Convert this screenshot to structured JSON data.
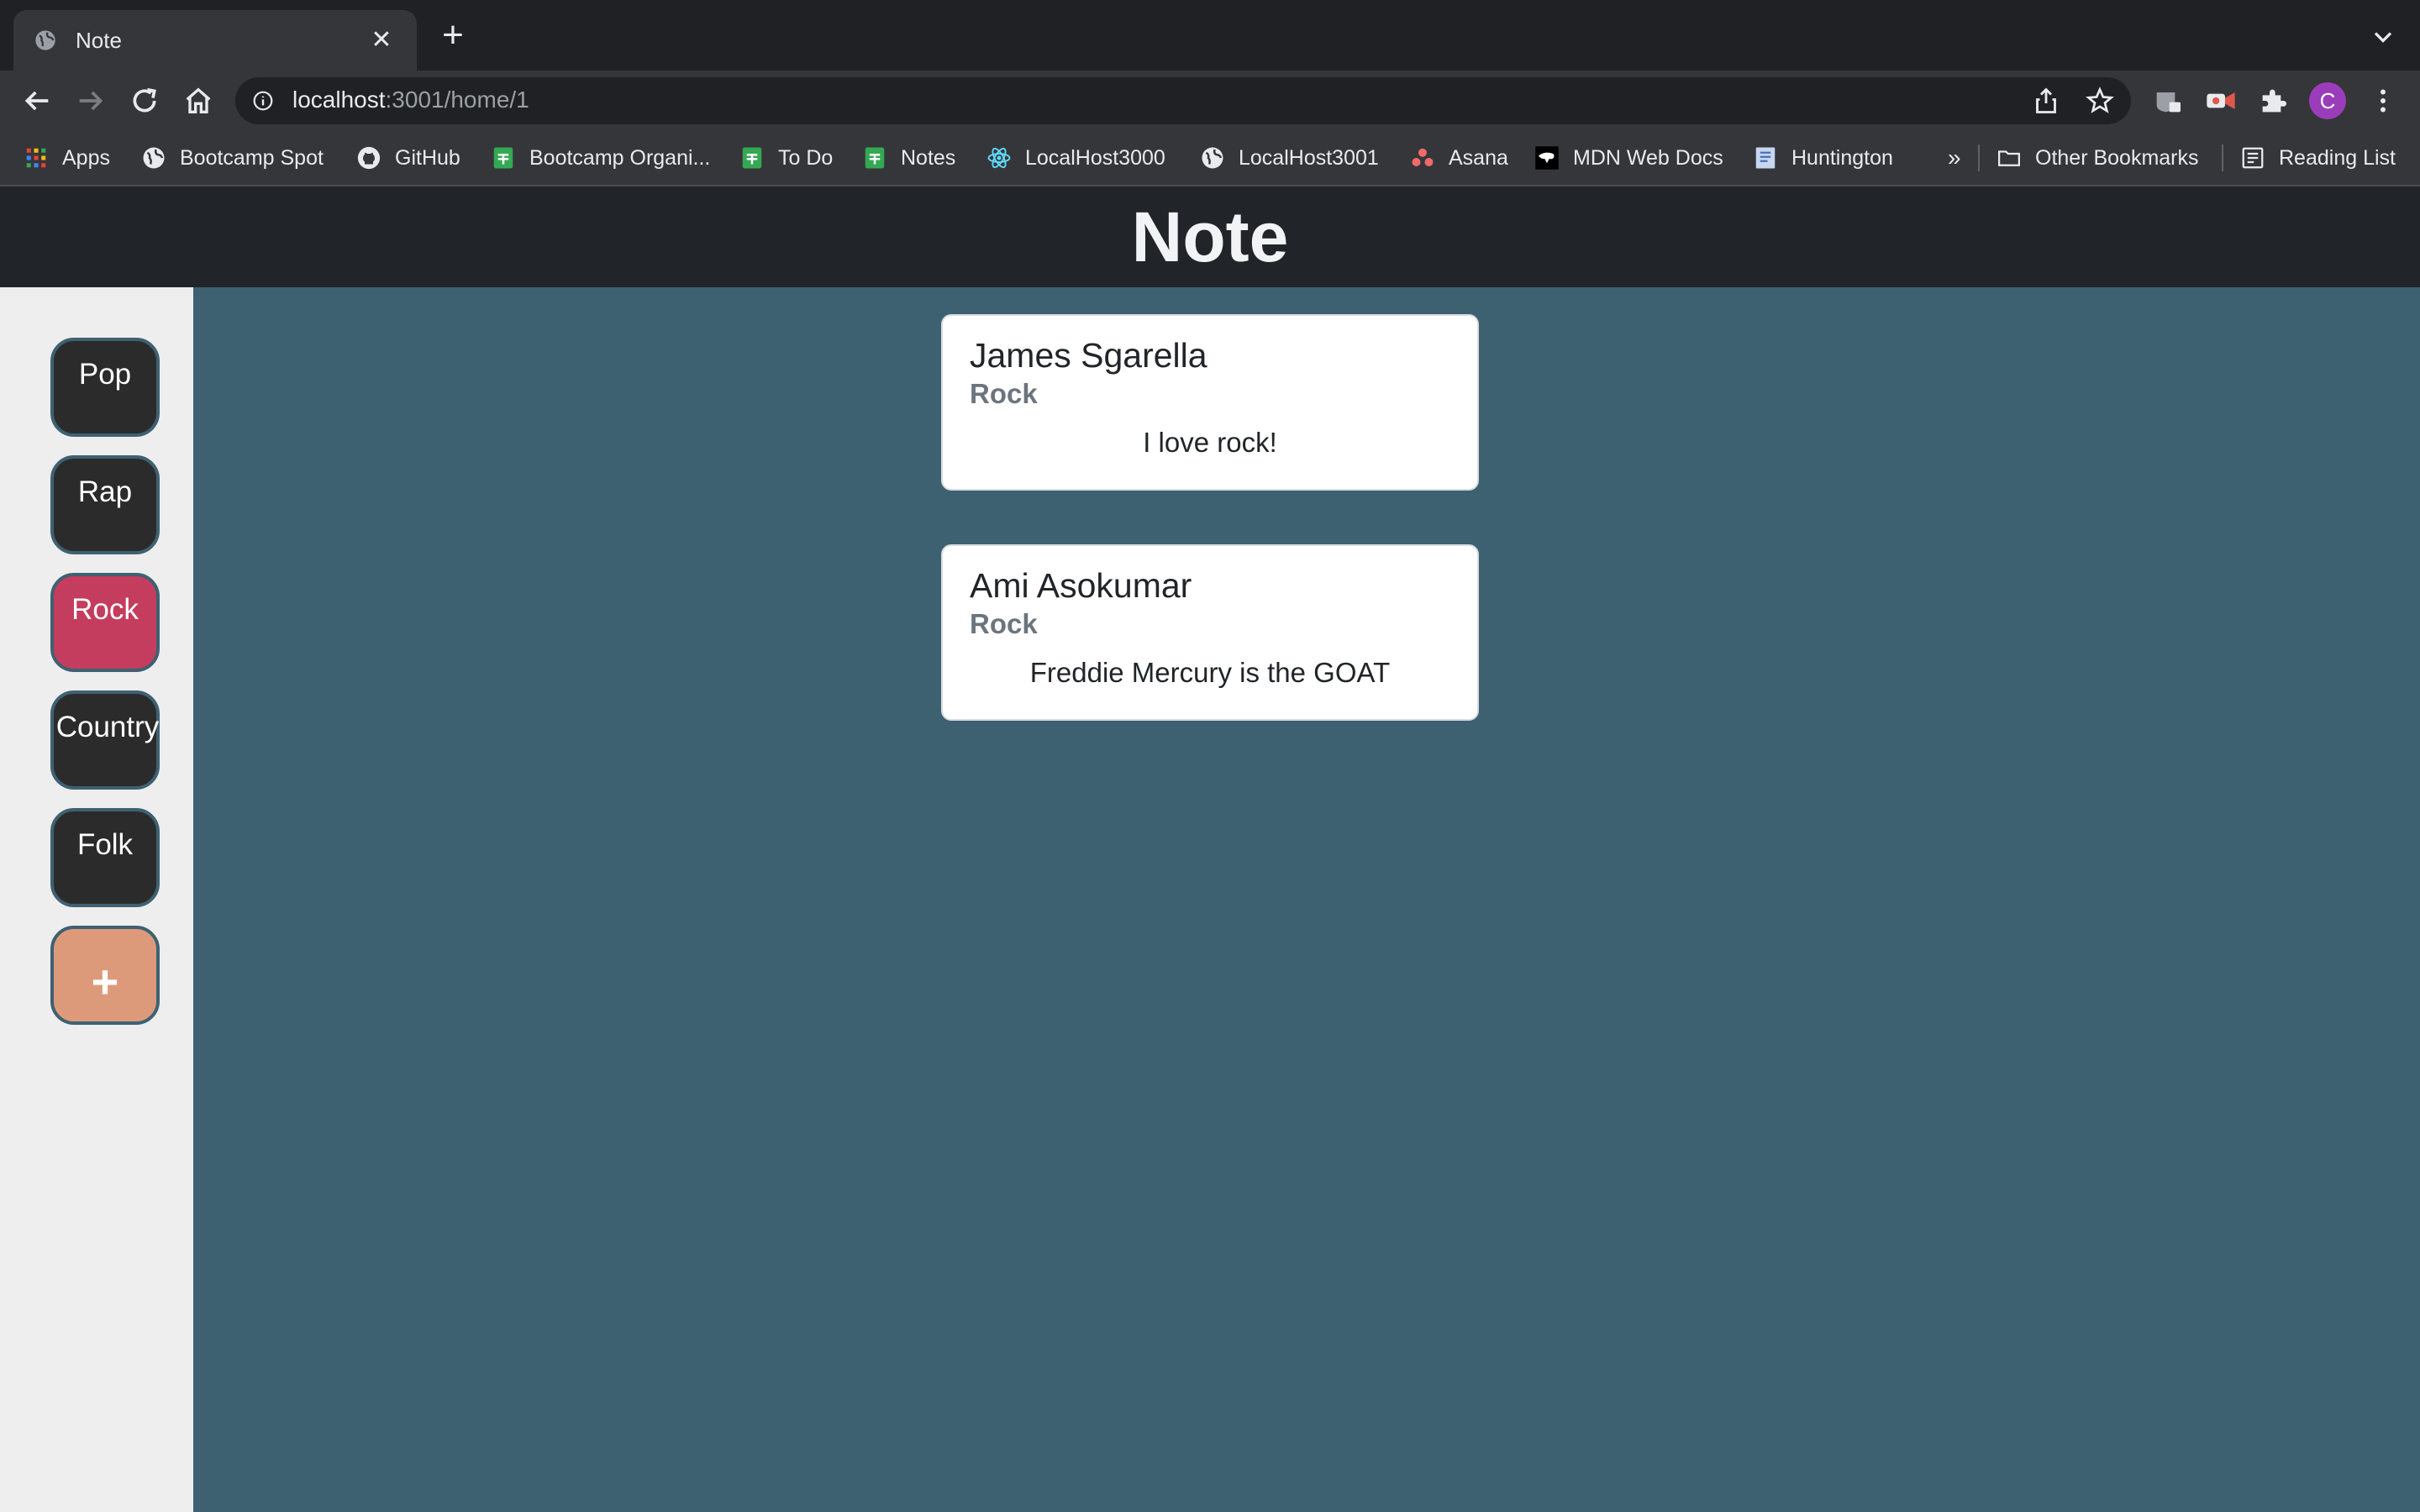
{
  "browser": {
    "tab_title": "Note",
    "url_host": "localhost",
    "url_path": ":3001/home/1",
    "profile_initial": "C",
    "bookmarks": [
      {
        "label": "Apps",
        "icon": "apps-grid-icon"
      },
      {
        "label": "Bootcamp Spot",
        "icon": "globe-icon"
      },
      {
        "label": "GitHub",
        "icon": "github-icon"
      },
      {
        "label": "Bootcamp Organi...",
        "icon": "sheets-icon"
      },
      {
        "label": "To Do",
        "icon": "sheets-icon"
      },
      {
        "label": "Notes",
        "icon": "sheets-icon"
      },
      {
        "label": "LocalHost3000",
        "icon": "react-icon"
      },
      {
        "label": "LocalHost3001",
        "icon": "globe-icon"
      },
      {
        "label": "Asana",
        "icon": "asana-icon"
      },
      {
        "label": "MDN Web Docs",
        "icon": "mdn-icon"
      },
      {
        "label": "Huntington",
        "icon": "document-icon"
      }
    ],
    "overflow_label": "»",
    "other_bookmarks": "Other Bookmarks",
    "reading_list": "Reading List"
  },
  "app": {
    "title": "Note",
    "genres": [
      {
        "label": "Pop",
        "active": false
      },
      {
        "label": "Rap",
        "active": false
      },
      {
        "label": "Rock",
        "active": true
      },
      {
        "label": "Country",
        "active": false
      },
      {
        "label": "Folk",
        "active": false
      }
    ],
    "add_label": "+",
    "notes": [
      {
        "author": "James Sgarella",
        "genre": "Rock",
        "text": "I love rock!"
      },
      {
        "author": "Ami Asokumar",
        "genre": "Rock",
        "text": "Freddie Mercury is the GOAT"
      }
    ],
    "colors": {
      "header": "#212529",
      "background": "#3e6172",
      "sidebar": "#eeeeee",
      "genre_button": "#2b2b2b",
      "active_genre": "#c43d5e",
      "add_button": "#dd9a7b"
    }
  }
}
